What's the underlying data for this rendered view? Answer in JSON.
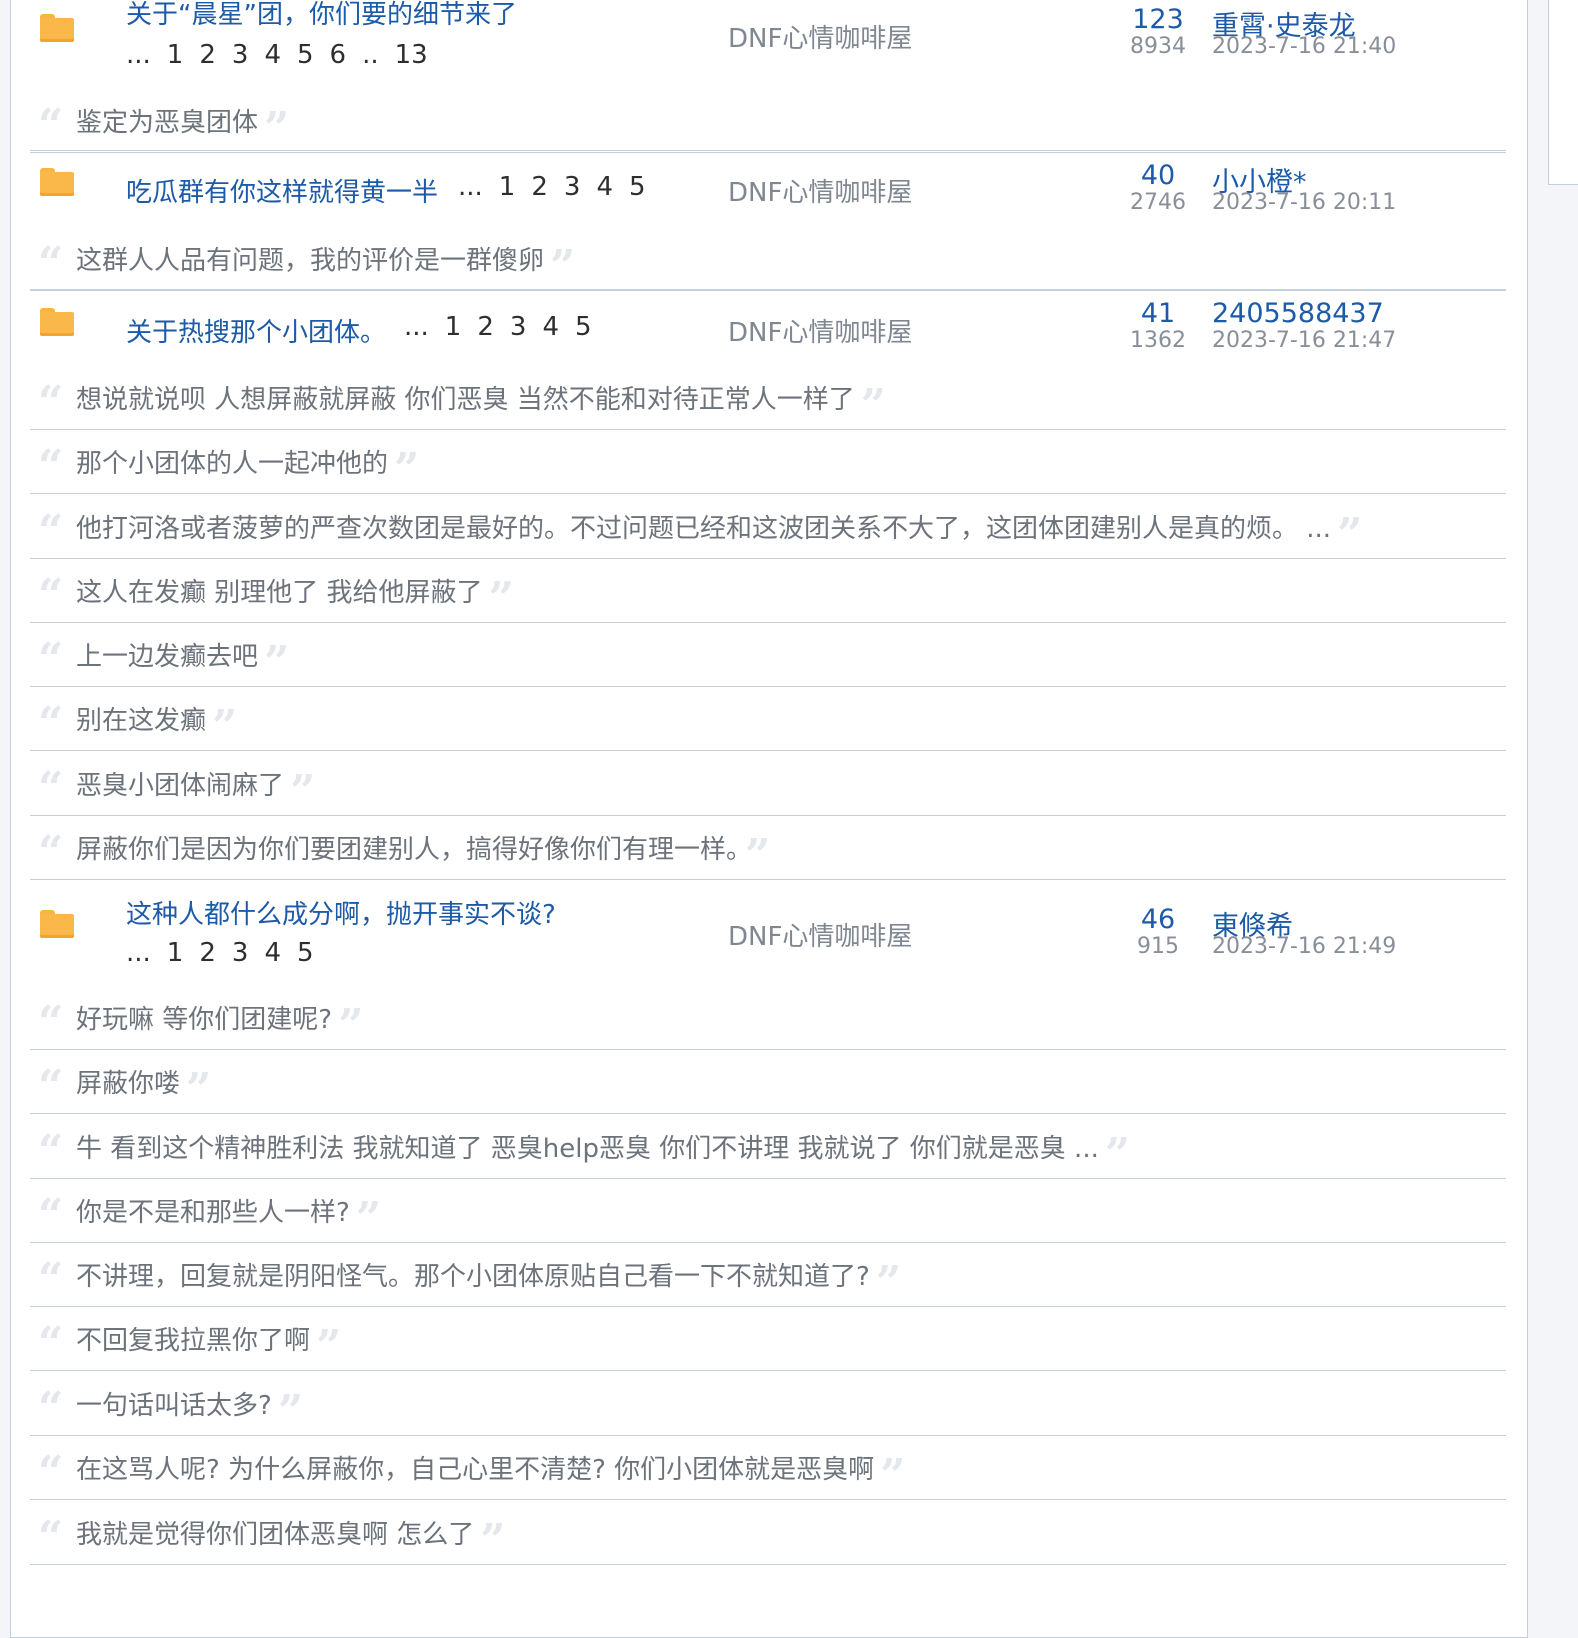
{
  "threads": [
    {
      "title": "关于“晨星”团，你们要的细节来了",
      "pages": [
        "...",
        "1",
        "2",
        "3",
        "4",
        "5",
        "6",
        "..",
        "13"
      ],
      "forum": "DNF心情咖啡屋",
      "replies": "123",
      "views": "8934",
      "last_user": "重霄·史泰龙",
      "last_time": "2023-7-16 21:40",
      "quotes": [
        "鉴定为恶臭团体"
      ]
    },
    {
      "title": "吃瓜群有你这样就得黄一半",
      "pages": [
        "...",
        "1",
        "2",
        "3",
        "4",
        "5"
      ],
      "forum": "DNF心情咖啡屋",
      "replies": "40",
      "views": "2746",
      "last_user": "小小橙*",
      "last_time": "2023-7-16 20:11",
      "quotes": [
        "这群人人品有问题，我的评价是一群傻卵"
      ]
    },
    {
      "title": "关于热搜那个小团体。",
      "pages": [
        "...",
        "1",
        "2",
        "3",
        "4",
        "5"
      ],
      "forum": "DNF心情咖啡屋",
      "replies": "41",
      "views": "1362",
      "last_user": "2405588437",
      "last_time": "2023-7-16 21:47",
      "quotes": [
        "想说就说呗 人想屏蔽就屏蔽 你们恶臭 当然不能和对待正常人一样了",
        "那个小团体的人一起冲他的",
        "他打河洛或者菠萝的严查次数团是最好的。不过问题已经和这波团关系不大了，这团体团建别人是真的烦。 ...",
        "这人在发癫 别理他了 我给他屏蔽了",
        "上一边发癫去吧",
        "别在这发癫",
        "恶臭小团体闹麻了",
        "屏蔽你们是因为你们要团建别人，搞得好像你们有理一样。"
      ]
    },
    {
      "title": "这种人都什么成分啊，抛开事实不谈?",
      "pages": [
        "...",
        "1",
        "2",
        "3",
        "4",
        "5"
      ],
      "forum": "DNF心情咖啡屋",
      "replies": "46",
      "views": "915",
      "last_user": "東倏希",
      "last_time": "2023-7-16 21:49",
      "quotes": [
        "好玩嘛 等你们团建呢?",
        "屏蔽你喽",
        "牛 看到这个精神胜利法 我就知道了 恶臭help恶臭 你们不讲理 我就说了 你们就是恶臭 ...",
        "你是不是和那些人一样?",
        "不讲理，回复就是阴阳怪气。那个小团体原贴自己看一下不就知道了?",
        "不回复我拉黑你了啊",
        "一句话叫话太多?",
        "在这骂人呢? 为什么屏蔽你，自己心里不清楚? 你们小团体就是恶臭啊",
        "我就是觉得你们团体恶臭啊 怎么了"
      ]
    }
  ],
  "icons": {
    "folder": "folder-icon",
    "open_quote": "open-quote-icon",
    "close_quote": "close-quote-icon"
  },
  "colors": {
    "link": "#1d5aa7",
    "muted": "#888f98",
    "quote_text": "#6d737b",
    "divider": "#c5d0dd",
    "folder": "#fbb84a"
  }
}
